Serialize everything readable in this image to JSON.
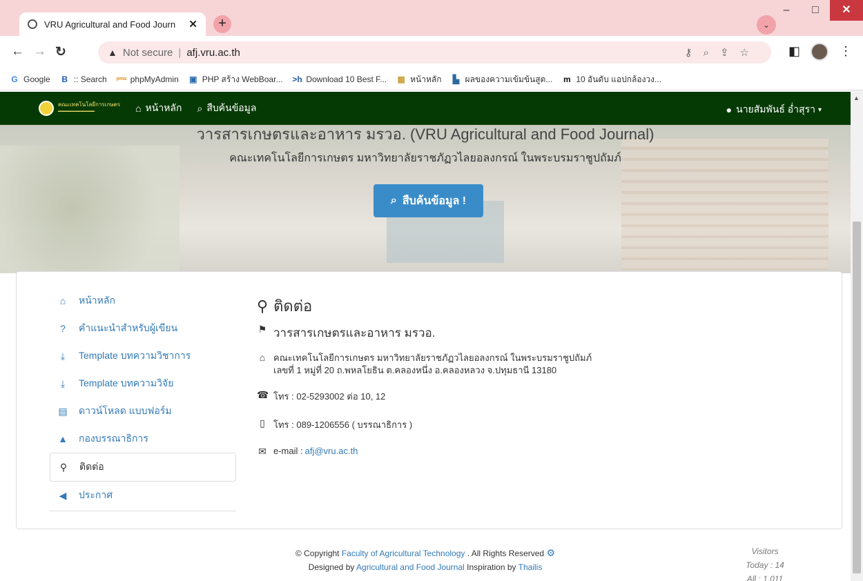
{
  "browser": {
    "tab_title": "VRU Agricultural and Food Journ",
    "new_tab": "+",
    "not_secure": "Not secure",
    "url": "afj.vru.ac.th",
    "bookmarks": [
      {
        "icon": "G",
        "label": "Google",
        "color": "#4285f4"
      },
      {
        "icon": "B",
        "label": ":: Search",
        "color": "#1a5bb5"
      },
      {
        "icon": "pma",
        "label": "phpMyAdmin",
        "color": "#e48b1b"
      },
      {
        "icon": "▣",
        "label": "PHP สร้าง WebBoar...",
        "color": "#2b6cb0"
      },
      {
        "icon": ">h",
        "label": "Download 10 Best F...",
        "color": "#1f5f9c"
      },
      {
        "icon": "▦",
        "label": "หน้าหลัก",
        "color": "#c9a23c"
      },
      {
        "icon": "▙",
        "label": "ผลของความเข้มข้นสูต...",
        "color": "#2c6a9f"
      },
      {
        "icon": "m",
        "label": "10 อันดับ แอปกล้องวง...",
        "color": "#111111"
      }
    ]
  },
  "nav": {
    "home": "หน้าหลัก",
    "search": "สืบค้นข้อมูล",
    "user": "นายสัมพันธ์ อ่ำสุรา"
  },
  "hero": {
    "title": "วารสารเกษตรและอาหาร มรวอ. (VRU Agricultural and Food Journal)",
    "subtitle": "คณะเทคโนโลยีการเกษตร มหาวิทยาลัยราชภัฏวไลยอลงกรณ์ ในพระบรมราชูปถัมภ์",
    "button": "สืบค้นข้อมูล !"
  },
  "sidebar": {
    "items": [
      {
        "label": "หน้าหลัก",
        "icon": "home-icon",
        "glyph": "⌂"
      },
      {
        "label": "คำแนะนำสำหรับผู้เขียน",
        "icon": "question-icon",
        "glyph": "?"
      },
      {
        "label": "Template บทความวิชาการ",
        "icon": "download-icon",
        "glyph": "⤓"
      },
      {
        "label": "Template บทความวิจัย",
        "icon": "download-icon",
        "glyph": "⤓"
      },
      {
        "label": "ดาวน์โหลด แบบฟอร์ม",
        "icon": "form-icon",
        "glyph": "▤"
      },
      {
        "label": "กองบรรณาธิการ",
        "icon": "education-icon",
        "glyph": "▲"
      },
      {
        "label": "ติดต่อ",
        "icon": "map-marker-icon",
        "glyph": "⚲"
      },
      {
        "label": "ประกาศ",
        "icon": "bullhorn-icon",
        "glyph": "◀"
      }
    ]
  },
  "contact": {
    "title": "ติดต่อ",
    "journal": "วารสารเกษตรและอาหาร มรวอ.",
    "address_line1": "คณะเทคโนโลยีการเกษตร มหาวิทยาลัยราชภัฏวไลยอลงกรณ์ ในพระบรมราชูปถัมภ์",
    "address_line2": "เลขที่ 1 หมู่ที่ 20 ถ.พหลโยธิน ต.คลองหนึ่ง อ.คลองหลวง จ.ปทุมธานี 13180",
    "phone_label": "โทร : 02-5293002 ต่อ 10, 12",
    "mobile_label": "โทร : 089-1206556 ( บรรณาธิการ )",
    "email_label": "e-mail : ",
    "email": "afj@vru.ac.th"
  },
  "footer": {
    "copyright_prefix": "© Copyright ",
    "faculty": "Faculty of Agricultural Technology",
    "rights": " . All Rights Reserved ",
    "designed_prefix": "Designed by ",
    "designer": "Agricultural and Food Journal",
    "inspiration_prefix": "  Inspiration by ",
    "inspiration": "Thailis",
    "visitors_title": "Visitors",
    "today": "Today : 14",
    "all": "All : 1,011"
  }
}
